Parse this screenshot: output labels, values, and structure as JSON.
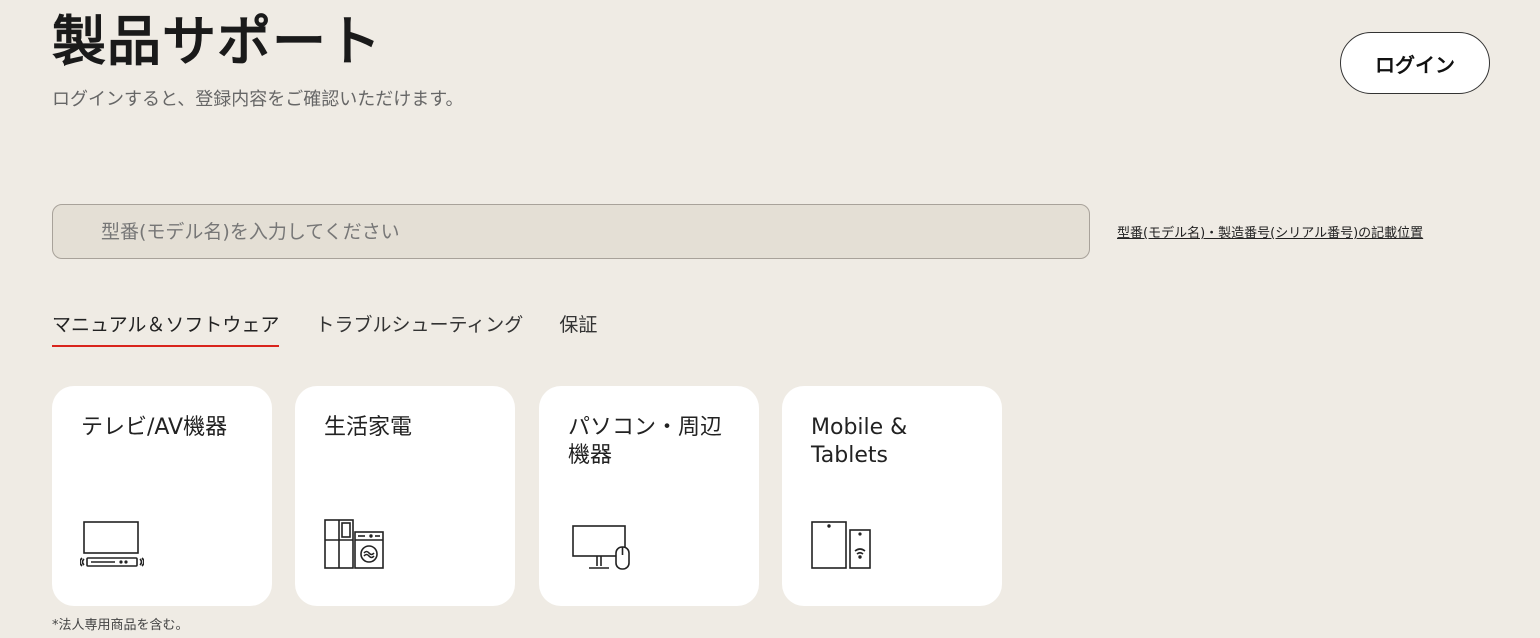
{
  "header": {
    "title": "製品サポート",
    "subtitle": "ログインすると、登録内容をご確認いただけます。",
    "login_label": "ログイン"
  },
  "search": {
    "placeholder": "型番(モデル名)を入力してください",
    "value": "",
    "help_link": "型番(モデル名)・製造番号(シリアル番号)の記載位置"
  },
  "tabs": [
    {
      "label": "マニュアル＆ソフトウェア",
      "active": true
    },
    {
      "label": "トラブルシューティング",
      "active": false
    },
    {
      "label": "保証",
      "active": false
    }
  ],
  "categories": [
    {
      "label": "テレビ/AV機器",
      "icon": "tv-soundbar-icon"
    },
    {
      "label": "生活家電",
      "icon": "fridge-washer-icon"
    },
    {
      "label": "パソコン・周辺機器",
      "icon": "monitor-mouse-icon"
    },
    {
      "label": "Mobile & Tablets",
      "icon": "tablet-phone-icon"
    }
  ],
  "footnote": "*法人専用商品を含む。",
  "colors": {
    "background": "#efebe4",
    "accent": "#d9241c",
    "card": "#ffffff"
  }
}
